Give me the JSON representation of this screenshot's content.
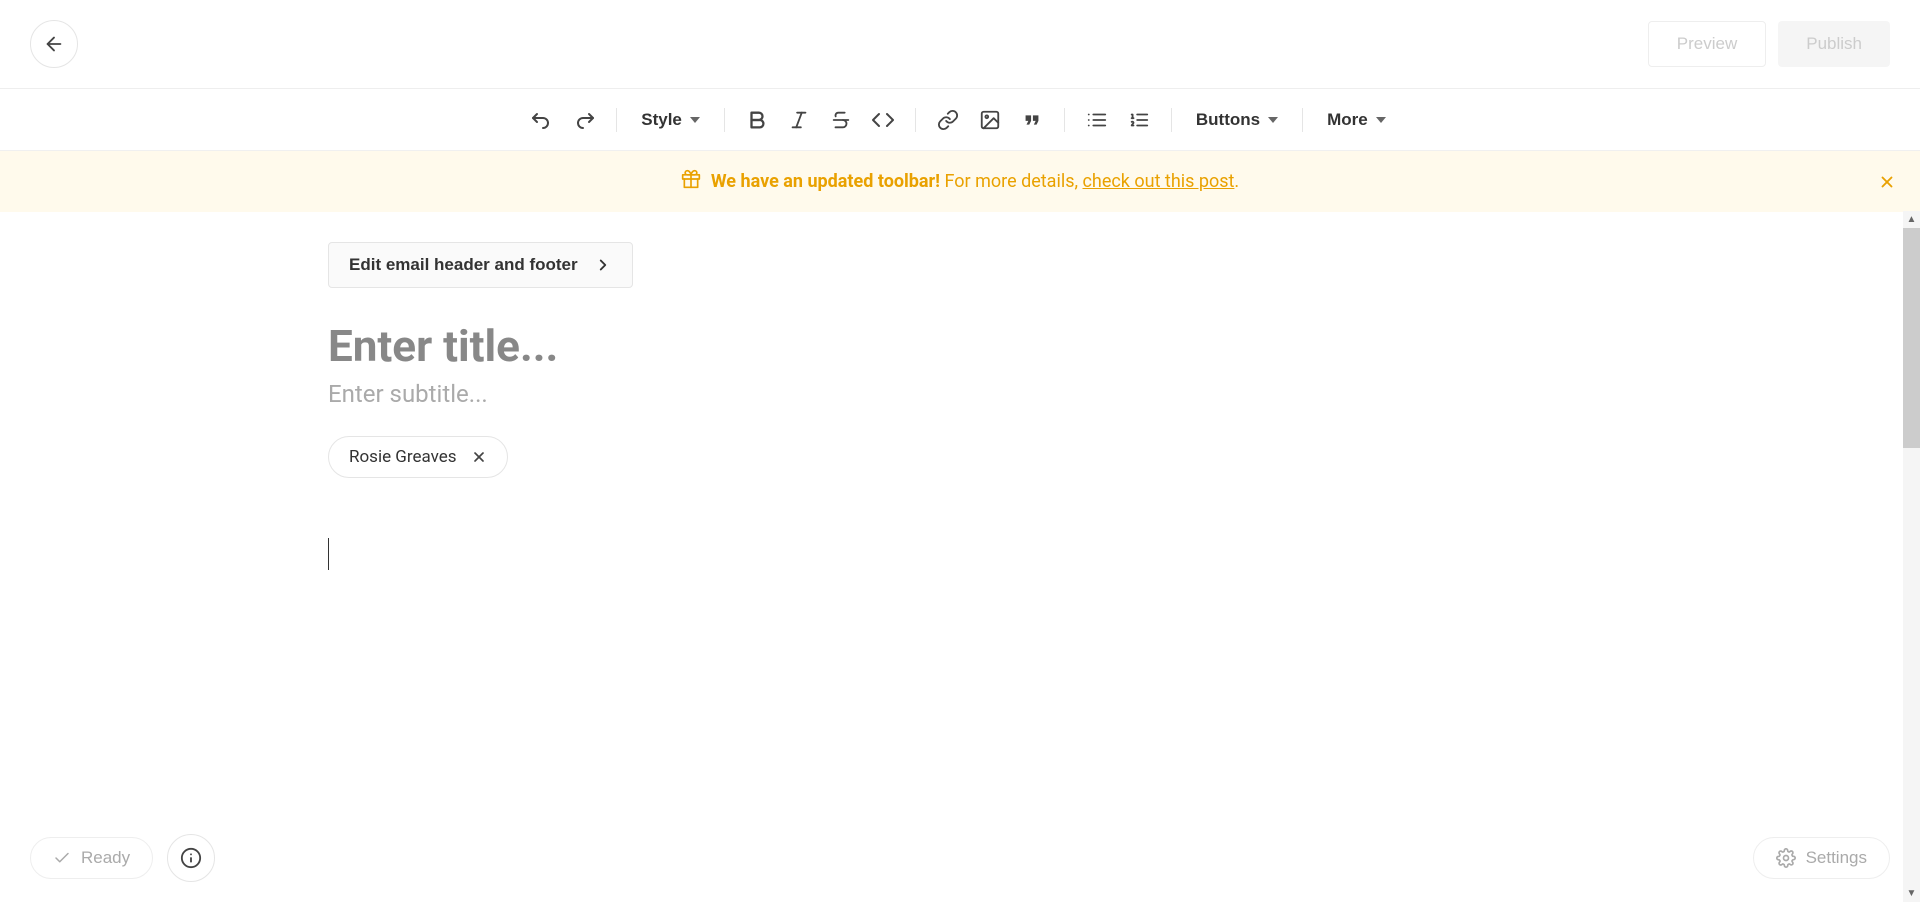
{
  "header": {
    "preview_label": "Preview",
    "publish_label": "Publish"
  },
  "toolbar": {
    "style_label": "Style",
    "buttons_label": "Buttons",
    "more_label": "More"
  },
  "banner": {
    "bold_text": "We have an updated toolbar!",
    "text": "For more details, ",
    "link_text": "check out this post",
    "period": "."
  },
  "editor": {
    "edit_header_label": "Edit email header and footer",
    "title_placeholder": "Enter title...",
    "title_value": "",
    "subtitle_placeholder": "Enter subtitle...",
    "subtitle_value": "",
    "author_name": "Rosie Greaves"
  },
  "bottom": {
    "ready_label": "Ready",
    "settings_label": "Settings"
  }
}
